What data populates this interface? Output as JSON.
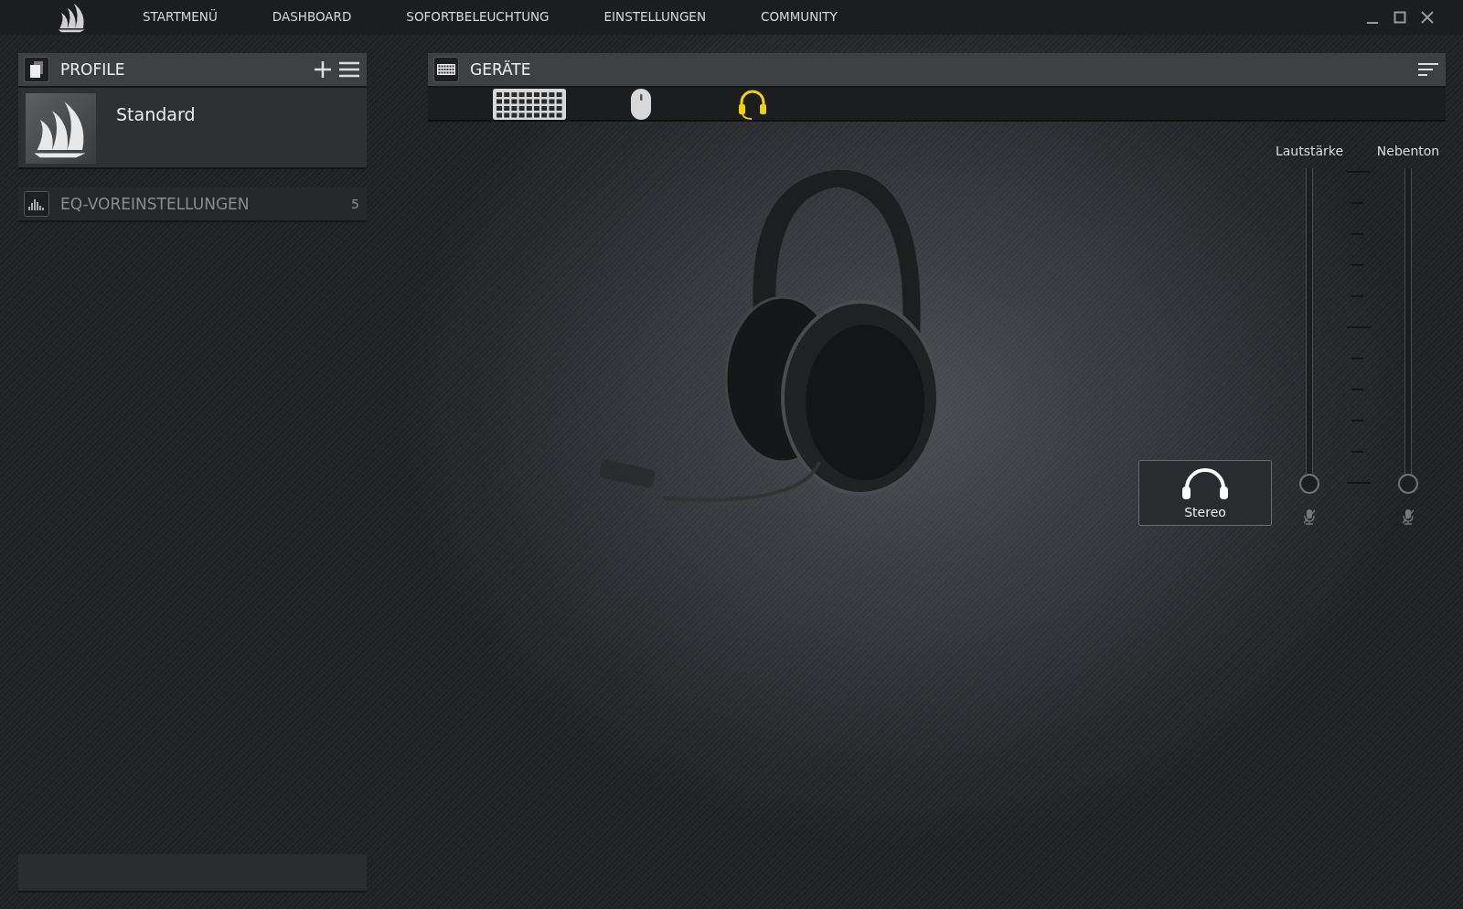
{
  "nav": {
    "items": [
      {
        "label": "STARTMENÜ",
        "selected": false
      },
      {
        "label": "DASHBOARD",
        "selected": false
      },
      {
        "label": "SOFORTBELEUCHTUNG",
        "selected": false
      },
      {
        "label": "EINSTELLUNGEN",
        "selected": false
      },
      {
        "label": "COMMUNITY",
        "selected": false
      }
    ]
  },
  "profiles": {
    "title": "PROFILE",
    "items": [
      {
        "name": "Standard",
        "selected": true
      }
    ]
  },
  "eq_presets": {
    "title": "EQ-VOREINSTELLUNGEN",
    "count": "5"
  },
  "devices": {
    "title": "GERÄTE",
    "items": [
      {
        "kind": "keyboard",
        "selected": false
      },
      {
        "kind": "mouse",
        "selected": false
      },
      {
        "kind": "headset",
        "selected": true
      }
    ]
  },
  "audio": {
    "mode_button": {
      "label": "Stereo"
    },
    "sliders": [
      {
        "label": "Lautstärke",
        "level": 0
      },
      {
        "label": "Nebenton",
        "level": 0
      }
    ]
  }
}
